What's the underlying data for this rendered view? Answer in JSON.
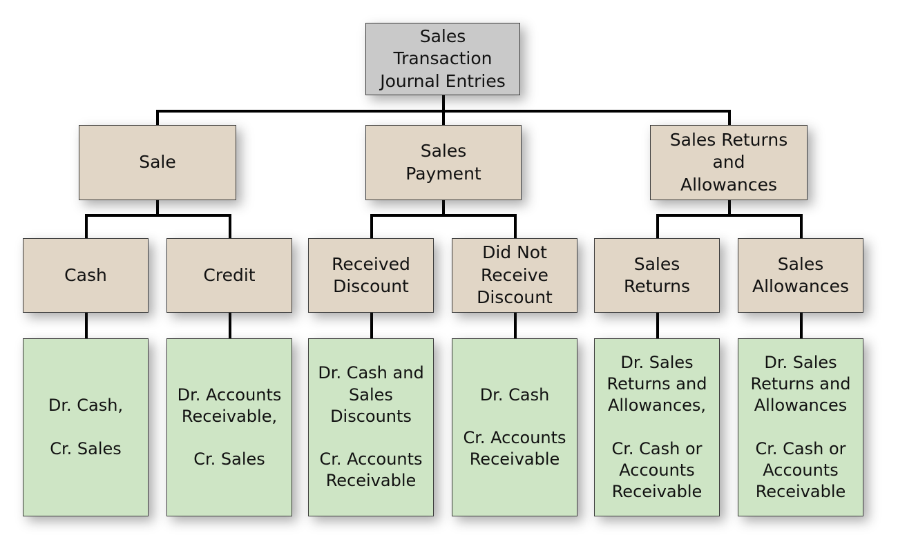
{
  "diagram": {
    "title": "Sales Transaction Journal Entries",
    "type": "tree-diagram",
    "colors": {
      "root_fill": "#c9c9c9",
      "category_fill": "#e1d6c6",
      "entry_fill": "#cee5c5",
      "border": "#3a3a3a",
      "connector": "#000000",
      "background": "#ffffff",
      "text": "#111111"
    },
    "root": {
      "label": "Sales\nTransaction\nJournal Entries"
    },
    "categories": [
      {
        "id": "sale",
        "label": "Sale"
      },
      {
        "id": "payment",
        "label": "Sales\nPayment"
      },
      {
        "id": "returns",
        "label": "Sales Returns\nand\nAllowances"
      }
    ],
    "subcategories": [
      {
        "id": "cash",
        "parent": "sale",
        "label": "Cash"
      },
      {
        "id": "credit",
        "parent": "sale",
        "label": "Credit"
      },
      {
        "id": "received-discount",
        "parent": "payment",
        "label": "Received\nDiscount"
      },
      {
        "id": "no-discount",
        "parent": "payment",
        "label": "Did Not\nReceive\nDiscount"
      },
      {
        "id": "sales-returns",
        "parent": "returns",
        "label": "Sales\nReturns"
      },
      {
        "id": "sales-allowances",
        "parent": "returns",
        "label": "Sales\nAllowances"
      }
    ],
    "entries": [
      {
        "id": "entry-cash",
        "parent": "cash",
        "label": "Dr. Cash,\n\nCr. Sales"
      },
      {
        "id": "entry-credit",
        "parent": "credit",
        "label": "Dr. Accounts\nReceivable,\n\nCr. Sales"
      },
      {
        "id": "entry-received-discount",
        "parent": "received-discount",
        "label": "Dr. Cash and\nSales\nDiscounts\n\nCr. Accounts\nReceivable"
      },
      {
        "id": "entry-no-discount",
        "parent": "no-discount",
        "label": "Dr. Cash\n\nCr. Accounts\nReceivable"
      },
      {
        "id": "entry-sales-returns",
        "parent": "sales-returns",
        "label": "Dr. Sales\nReturns and\nAllowances,\n\nCr. Cash or\nAccounts\nReceivable"
      },
      {
        "id": "entry-sales-allowances",
        "parent": "sales-allowances",
        "label": "Dr. Sales\nReturns and\nAllowances\n\nCr. Cash or\nAccounts\nReceivable"
      }
    ]
  }
}
